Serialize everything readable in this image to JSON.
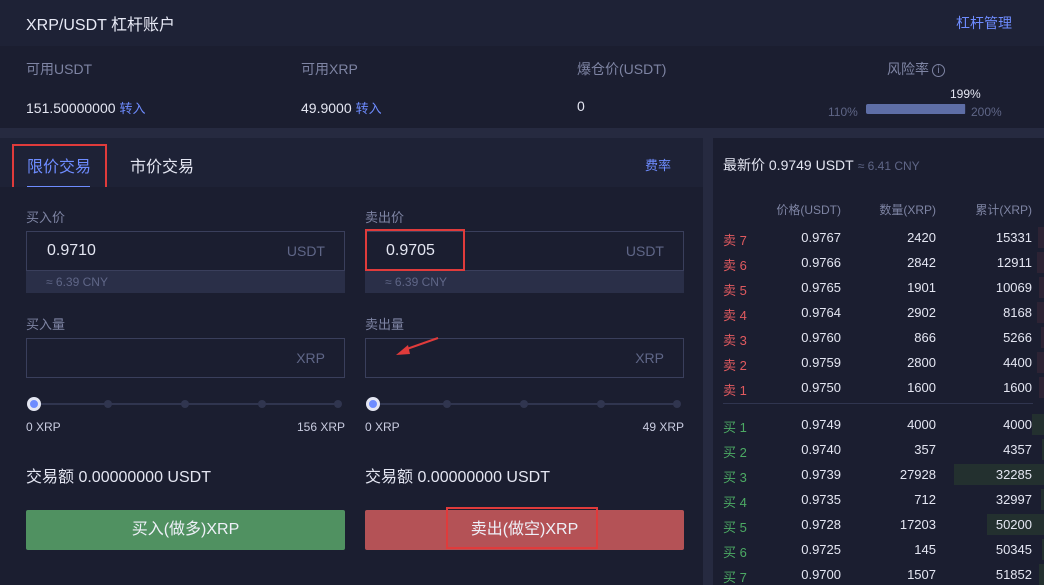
{
  "header": {
    "title": "XRP/USDT 杠杆账户",
    "manage_label": "杠杆管理"
  },
  "account": {
    "available_usdt_label": "可用USDT",
    "available_usdt_value": "151.50000000",
    "available_xrp_label": "可用XRP",
    "available_xrp_value": "49.9000",
    "transfer_label": "转入",
    "liquidation_label": "爆仓价(USDT)",
    "liquidation_value": "0",
    "risk_label": "风险率",
    "risk_icon": "info-icon",
    "risk_current": "199%",
    "risk_min": "110%",
    "risk_max": "200%",
    "risk_fraction": 0.99
  },
  "tabs": {
    "limit": "限价交易",
    "market": "市价交易",
    "fee": "费率"
  },
  "buy": {
    "price_label": "买入价",
    "price_value": "0.9710",
    "price_unit": "USDT",
    "cny": "≈ 6.39 CNY",
    "amount_label": "买入量",
    "amount_unit": "XRP",
    "slider_min": "0 XRP",
    "slider_max": "156 XRP",
    "total": "交易额 0.00000000 USDT",
    "button": "买入(做多)XRP"
  },
  "sell": {
    "price_label": "卖出价",
    "price_value": "0.9705",
    "price_unit": "USDT",
    "cny": "≈ 6.39 CNY",
    "amount_label": "卖出量",
    "amount_unit": "XRP",
    "slider_min": "0 XRP",
    "slider_max": "49 XRP",
    "total": "交易额 0.00000000 USDT",
    "button": "卖出(做空)XRP"
  },
  "orderbook": {
    "last_price": "最新价 0.9749 USDT",
    "last_price_cny": "≈ 6.41 CNY",
    "headers": [
      "价格(USDT)",
      "数量(XRP)",
      "累计(XRP)"
    ],
    "asks": [
      {
        "side": "卖 7",
        "price": "0.9767",
        "qty": "2420",
        "cum": "15331",
        "depth": 0.06
      },
      {
        "side": "卖 6",
        "price": "0.9766",
        "qty": "2842",
        "cum": "12911",
        "depth": 0.07
      },
      {
        "side": "卖 5",
        "price": "0.9765",
        "qty": "1901",
        "cum": "10069",
        "depth": 0.05
      },
      {
        "side": "卖 4",
        "price": "0.9764",
        "qty": "2902",
        "cum": "8168",
        "depth": 0.07
      },
      {
        "side": "卖 3",
        "price": "0.9760",
        "qty": "866",
        "cum": "5266",
        "depth": 0.03
      },
      {
        "side": "卖 2",
        "price": "0.9759",
        "qty": "2800",
        "cum": "4400",
        "depth": 0.07
      },
      {
        "side": "卖 1",
        "price": "0.9750",
        "qty": "1600",
        "cum": "1600",
        "depth": 0.05
      }
    ],
    "bids": [
      {
        "side": "买 1",
        "price": "0.9749",
        "qty": "4000",
        "cum": "4000",
        "depth": 0.13
      },
      {
        "side": "买 2",
        "price": "0.9740",
        "qty": "357",
        "cum": "4357",
        "depth": 0.02
      },
      {
        "side": "买 3",
        "price": "0.9739",
        "qty": "27928",
        "cum": "32285",
        "depth": 0.95
      },
      {
        "side": "买 4",
        "price": "0.9735",
        "qty": "712",
        "cum": "32997",
        "depth": 0.03
      },
      {
        "side": "买 5",
        "price": "0.9728",
        "qty": "17203",
        "cum": "50200",
        "depth": 0.6
      },
      {
        "side": "买 6",
        "price": "0.9725",
        "qty": "145",
        "cum": "50345",
        "depth": 0.01
      },
      {
        "side": "买 7",
        "price": "0.9700",
        "qty": "1507",
        "cum": "51852",
        "depth": 0.05
      }
    ]
  }
}
